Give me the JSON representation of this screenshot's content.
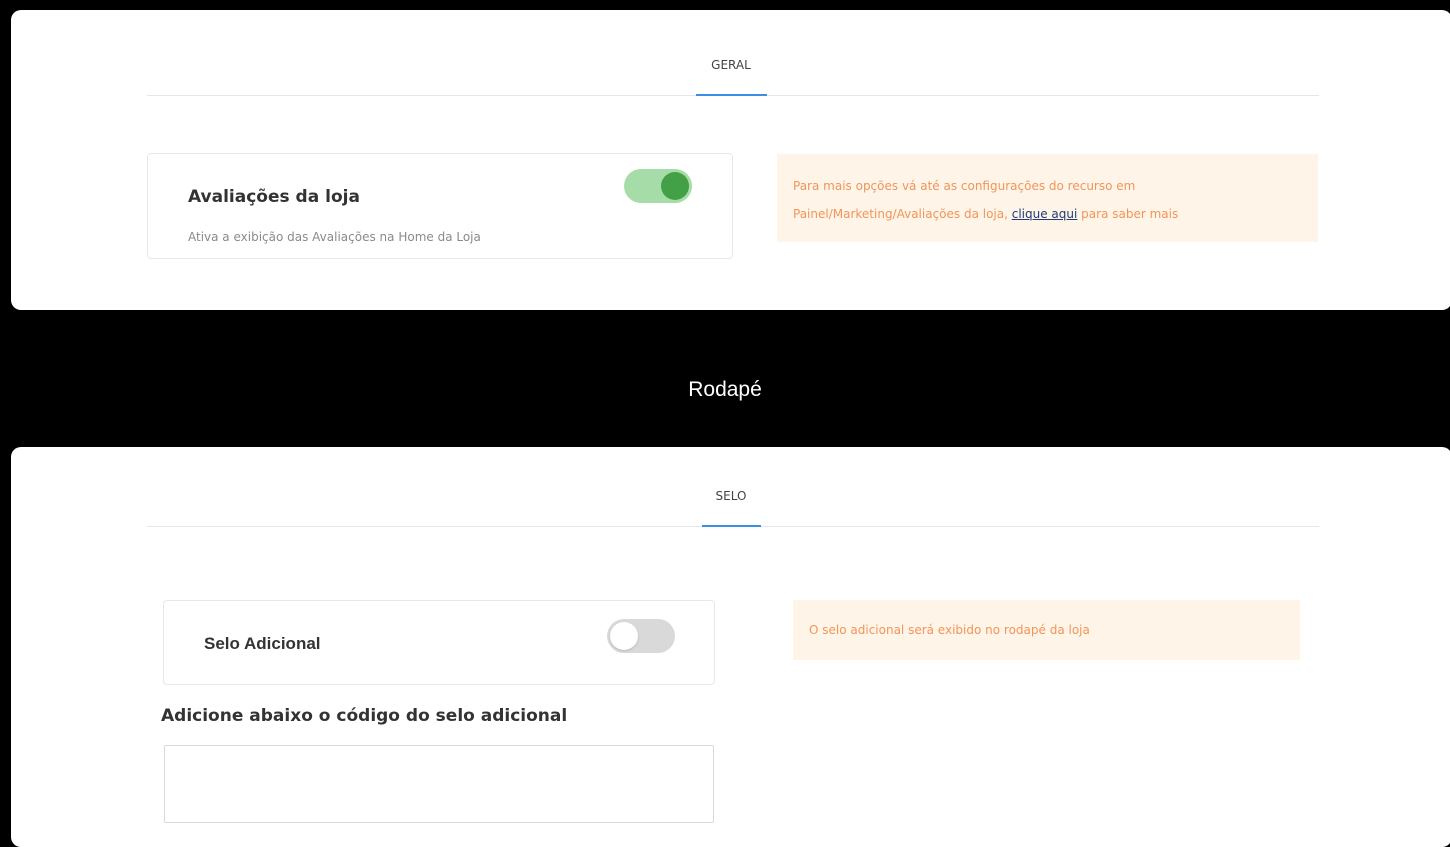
{
  "panel_geral": {
    "tab_label": "GERAL",
    "card": {
      "title": "Avaliações da loja",
      "description": "Ativa a exibição das Avaliações na Home da Loja",
      "toggle_on": true
    },
    "note": {
      "line1": "Para mais opções vá até as configurações do recurso em",
      "line2_prefix": "Painel/Marketing/Avaliações da loja, ",
      "link_text": "clique aqui",
      "line2_suffix": " para saber mais"
    }
  },
  "section_heading": "Rodapé",
  "panel_selo": {
    "tab_label": "SELO",
    "card": {
      "title": "Selo Adicional",
      "toggle_on": false
    },
    "note": "O selo adicional será exibido no rodapé da loja",
    "code_label": "Adicione abaixo o código do selo adicional",
    "code_value": ""
  },
  "colors": {
    "accent_tab": "#3b8fe0",
    "toggle_on": "#43a047",
    "note_bg": "#fff4e8",
    "note_text": "#f0955a"
  }
}
